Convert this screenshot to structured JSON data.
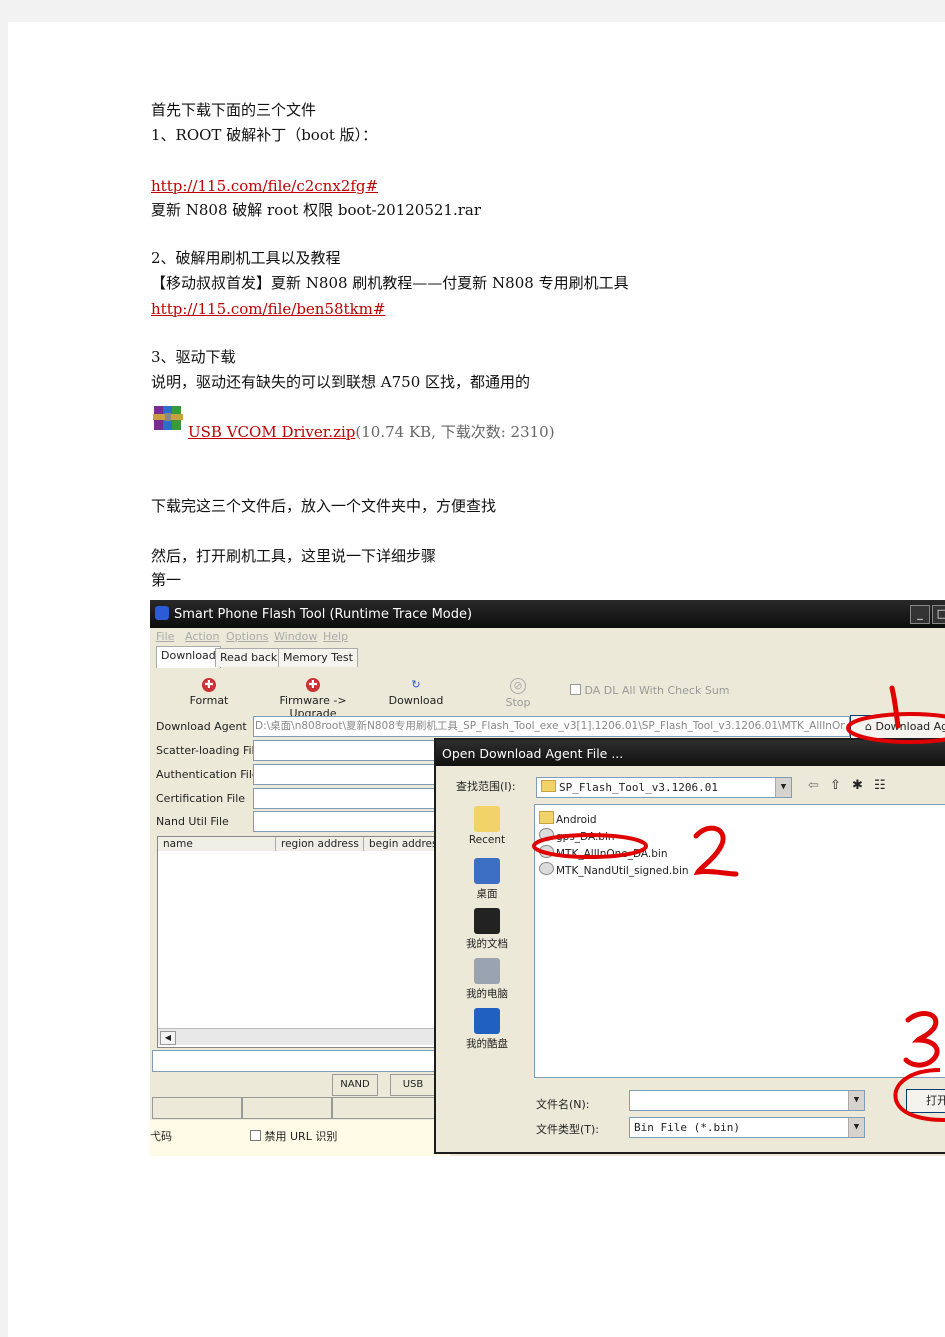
{
  "doc": {
    "intro": "首先下载下面的三个文件",
    "item1_title": "1、ROOT 破解补丁（boot 版）：",
    "item1_link": "http://115.com/file/c2cnx2fg#",
    "item1_file": "夏新 N808 破解 root 权限 boot-20120521.rar",
    "item2_title": "2、破解用刷机工具以及教程",
    "item2_desc": "【移动叔叔首发】夏新 N808 刷机教程——付夏新 N808 专用刷机工具",
    "item2_link": "http://115.com/file/ben58tkm#",
    "item3_title": "3、驱动下载",
    "item3_desc": "说明，驱动还有缺失的可以到联想 A750 区找，都通用的",
    "item3_link": "USB VCOM Driver.zip",
    "item3_meta": "(10.74 KB, 下载次数: 2310)",
    "after_download": "下载完这三个文件后，放入一个文件夹中，方便查找",
    "then": "然后，打开刷机工具，这里说一下详细步骤",
    "step1": "第一"
  },
  "app": {
    "title": "Smart Phone Flash Tool (Runtime Trace Mode)",
    "menu": [
      "File",
      "Action",
      "Options",
      "Window",
      "Help"
    ],
    "tabs": [
      "Download",
      "Read back",
      "Memory Test"
    ],
    "tools": [
      "Format",
      "Firmware -> Upgrade",
      "Download",
      "Stop"
    ],
    "checksum_label": "DA DL All With Check Sum",
    "fields": [
      "Download Agent",
      "Scatter-loading File",
      "Authentication File",
      "Certification File",
      "Nand Util File"
    ],
    "download_agent_path": "D:\\桌面\\n808root\\夏新N808专用刷机工具_SP_Flash_Tool_exe_v3[1].1206.01\\SP_Flash_Tool_v3.1206.01\\MTK_AllInOne_",
    "download_agent_button": "Download Ag",
    "columns": [
      "name",
      "region address",
      "begin address"
    ],
    "status": [
      "NAND",
      "USB"
    ]
  },
  "dialog": {
    "title": "Open Download Agent File ...",
    "lookin_label": "查找范围(I):",
    "lookin_value": "SP_Flash_Tool_v3.1206.01",
    "places": [
      "Recent",
      "桌面",
      "我的文档",
      "我的电脑",
      "我的酷盘"
    ],
    "files": [
      "Android",
      "gps_DA.bin",
      "MTK_AllInOne_DA.bin",
      "MTK_NandUtil_signed.bin"
    ],
    "filename_label": "文件名(N):",
    "filetype_label": "文件类型(T):",
    "filetype_value": "Bin File (*.bin)",
    "open_button": "打开"
  },
  "underlay": {
    "left_label": "弋码",
    "checkbox1": "禁用 URL 识别"
  },
  "colors": {
    "link": "#c00000",
    "annotation": "#e00000",
    "titlebar": "#111111"
  }
}
